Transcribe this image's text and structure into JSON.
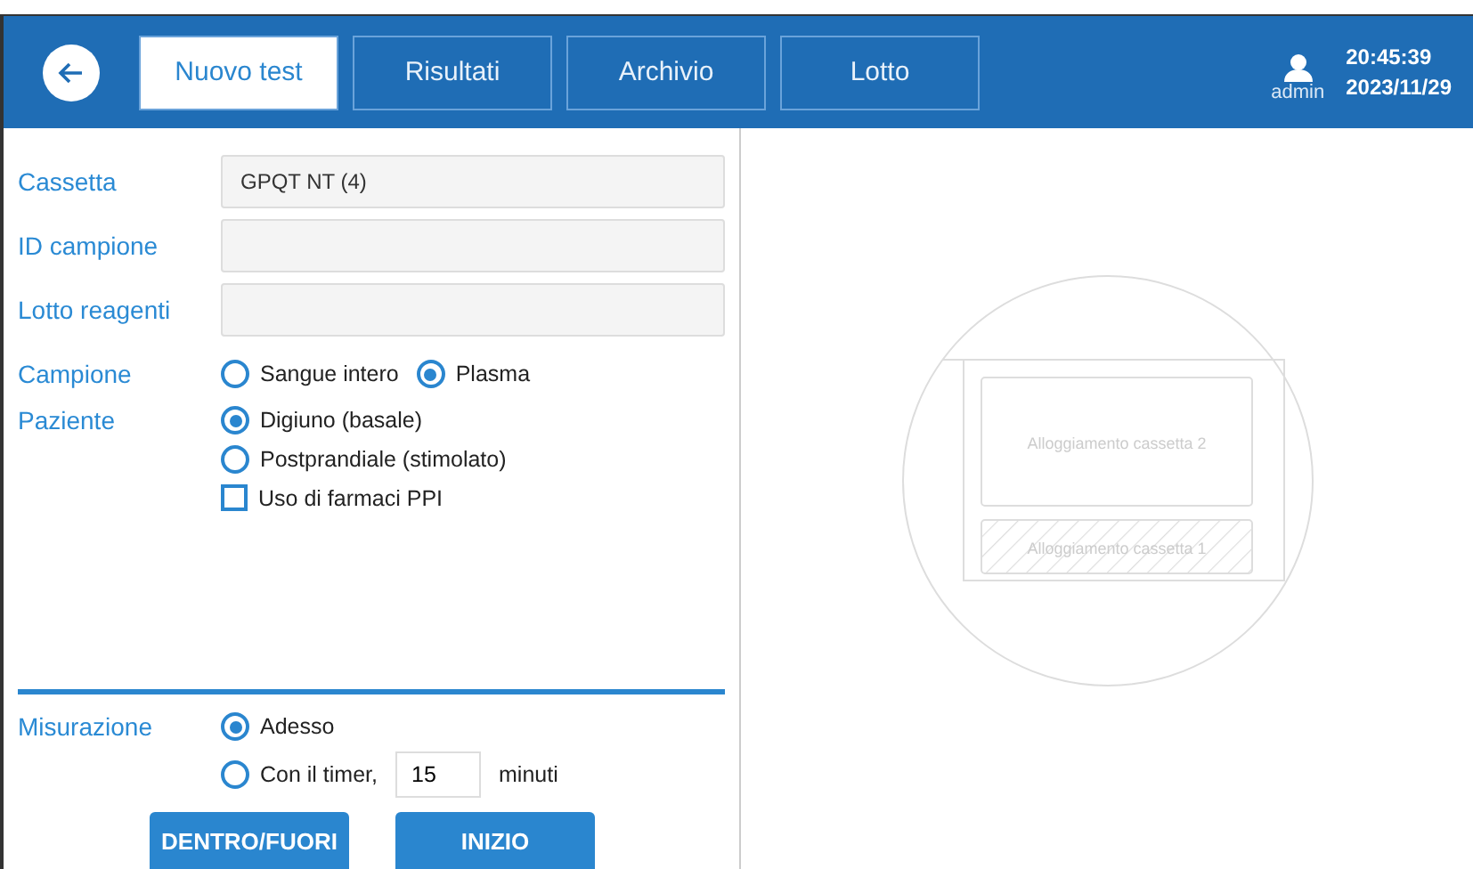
{
  "header": {
    "tabs": [
      {
        "label": "Nuovo test",
        "selected": true
      },
      {
        "label": "Risultati",
        "selected": false
      },
      {
        "label": "Archivio",
        "selected": false
      },
      {
        "label": "Lotto",
        "selected": false
      }
    ],
    "user": "admin",
    "time": "20:45:39",
    "date": "2023/11/29"
  },
  "form": {
    "fields": [
      {
        "label": "Cassetta",
        "value": "GPQT NT (4)"
      },
      {
        "label": "ID campione"
      },
      {
        "label": "Lotto reagenti"
      }
    ],
    "campione": {
      "label": "Campione",
      "options": [
        {
          "label": "Sangue intero",
          "selected": false
        },
        {
          "label": "Plasma",
          "selected": true
        }
      ]
    },
    "paziente": {
      "label": "Paziente",
      "options": [
        {
          "label": "Digiuno (basale)",
          "selected": true
        },
        {
          "label": "Postprandiale (stimolato)",
          "selected": false
        }
      ],
      "checkbox": {
        "label": "Uso di farmaci PPI",
        "checked": false
      }
    },
    "misurazione": {
      "label": "Misurazione",
      "options": [
        {
          "label": "Adesso",
          "selected": true
        },
        {
          "label": "Con il timer,",
          "selected": false
        }
      ],
      "timer_value": "15",
      "timer_unit": "minuti"
    },
    "buttons": [
      "DENTRO/FUORI",
      "INIZIO"
    ]
  },
  "drawer": {
    "slots": [
      {
        "label": "Alloggiamento cassetta 2",
        "hatched": false
      },
      {
        "label": "Alloggiamento cassetta 1",
        "hatched": true
      }
    ]
  }
}
